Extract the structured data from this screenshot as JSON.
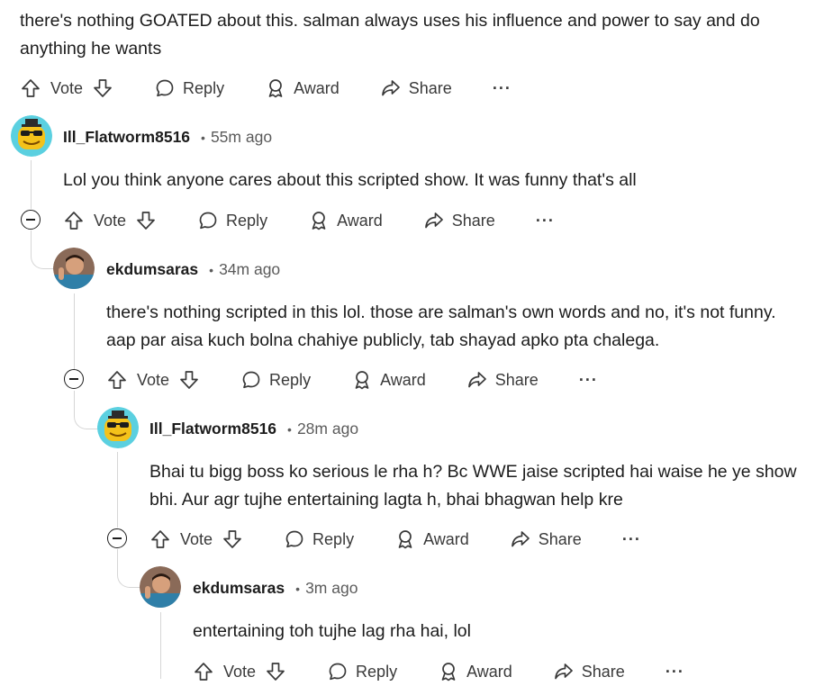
{
  "actions": {
    "vote": "Vote",
    "reply": "Reply",
    "award": "Award",
    "share": "Share",
    "more": "···"
  },
  "comments": [
    {
      "text": "there's nothing GOATED about this. salman always uses his influence and power to say and do anything he wants"
    },
    {
      "username": "Ill_Flatworm8516",
      "time": "55m ago",
      "text": "Lol you think anyone cares about this scripted show. It was funny that's all"
    },
    {
      "username": "ekdumsaras",
      "time": "34m ago",
      "text": "there's nothing scripted in this lol. those are salman's own words and no, it's not funny. aap par aisa kuch bolna chahiye publicly, tab shayad apko pta chalega."
    },
    {
      "username": "Ill_Flatworm8516",
      "time": "28m ago",
      "text": "Bhai tu bigg boss ko serious le rha h? Bc WWE jaise scripted hai waise he ye show bhi. Aur agr tujhe entertaining lagta h, bhai bhagwan help kre"
    },
    {
      "username": "ekdumsaras",
      "time": "3m ago",
      "text": "entertaining toh tujhe lag rha hai, lol"
    }
  ],
  "colors": {
    "text": "#1c1c1c",
    "muted": "#5b5b5b",
    "thread_line": "#d6d6d6",
    "snoo_bg": "#5bd0e0",
    "snoo_body": "#f4c21a"
  }
}
